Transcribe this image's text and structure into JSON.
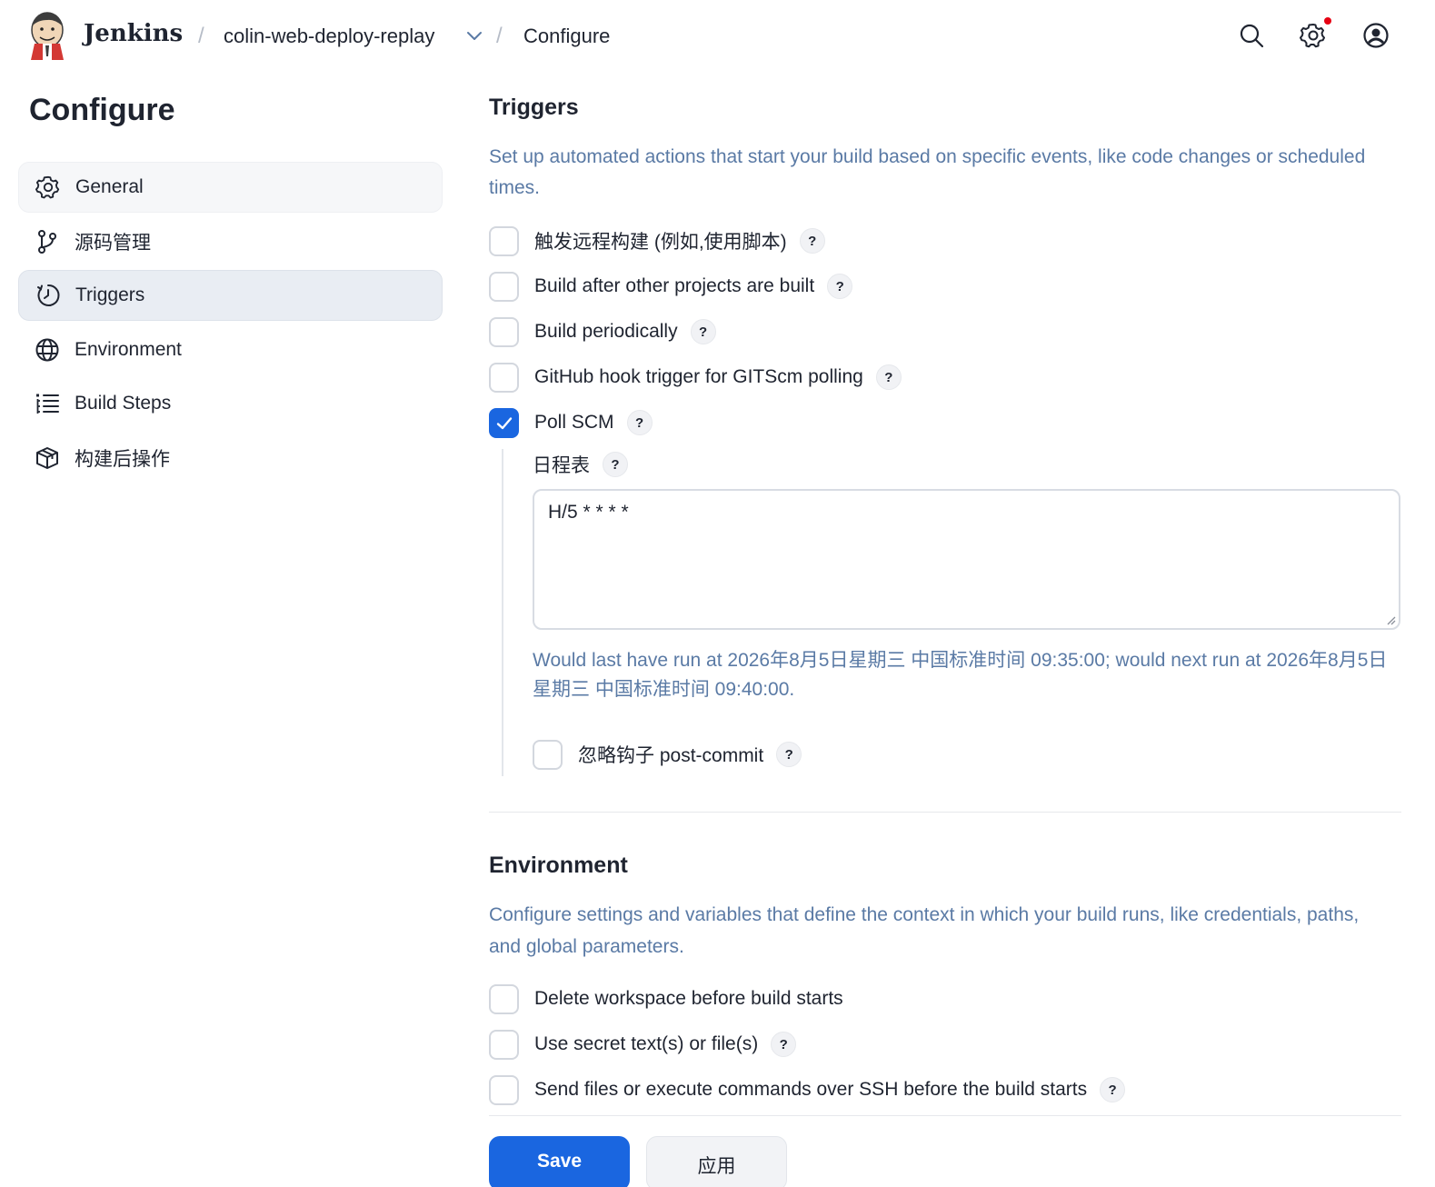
{
  "header": {
    "brand": "Jenkins",
    "crumbs": [
      "colin-web-deploy-replay",
      "Configure"
    ],
    "separator": "/"
  },
  "sidebar": {
    "title": "Configure",
    "items": [
      {
        "label": "General",
        "icon": "gear-icon"
      },
      {
        "label": "源码管理",
        "icon": "source-branch-icon"
      },
      {
        "label": "Triggers",
        "icon": "clock-icon"
      },
      {
        "label": "Environment",
        "icon": "globe-icon"
      },
      {
        "label": "Build Steps",
        "icon": "list-icon"
      },
      {
        "label": "构建后操作",
        "icon": "package-icon"
      }
    ]
  },
  "triggers": {
    "title": "Triggers",
    "description": "Set up automated actions that start your build based on specific events, like code changes or scheduled times.",
    "options": [
      {
        "label": "触发远程构建 (例如,使用脚本)",
        "checked": false
      },
      {
        "label": "Build after other projects are built",
        "checked": false
      },
      {
        "label": "Build periodically",
        "checked": false
      },
      {
        "label": "GitHub hook trigger for GITScm polling",
        "checked": false
      },
      {
        "label": "Poll SCM",
        "checked": true
      }
    ],
    "schedule": {
      "label": "日程表",
      "value": "H/5 * * * *",
      "hint": "Would last have run at 2026年8月5日星期三 中国标准时间 09:35:00; would next run at 2026年8月5日星期三 中国标准时间 09:40:00.",
      "ignore_post_commit": "忽略钩子 post-commit"
    }
  },
  "environment": {
    "title": "Environment",
    "description": "Configure settings and variables that define the context in which your build runs, like credentials, paths, and global parameters.",
    "options": [
      {
        "label": "Delete workspace before build starts",
        "checked": false
      },
      {
        "label": "Use secret text(s) or file(s)",
        "checked": false
      },
      {
        "label": "Send files or execute commands over SSH before the build starts",
        "checked": false
      }
    ]
  },
  "help_glyph": "?",
  "actions": {
    "save": "Save",
    "apply": "应用"
  },
  "colors": {
    "accent": "#1a66e0",
    "hint": "#5a7aa5",
    "notification": "#e60012"
  }
}
